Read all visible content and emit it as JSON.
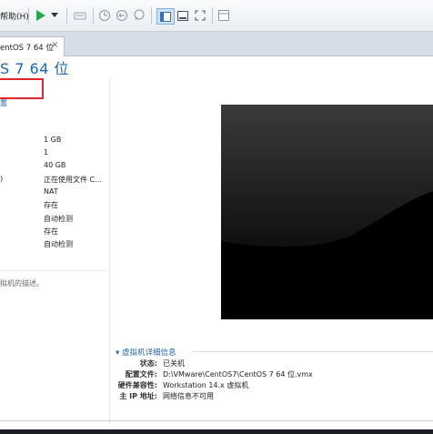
{
  "menu": {
    "help_label": "帮助(H)"
  },
  "toolbar": {
    "icons": [
      "play-icon",
      "dropdown-arrow-icon",
      "send-keys-icon",
      "snapshot-icon",
      "revert-snapshot-icon",
      "snapshot-manager-icon",
      "normal-view-icon",
      "console-view-icon",
      "fullscreen-icon",
      "unity-icon"
    ]
  },
  "tab": {
    "label": "entOS 7 64 位",
    "close": "×"
  },
  "vm": {
    "title": "S 7 64 位"
  },
  "left": {
    "edit_link": "置",
    "devices": [
      {
        "name": "",
        "value": "1 GB"
      },
      {
        "name": "",
        "value": "1"
      },
      {
        "name": "",
        "value": "40 GB"
      },
      {
        "name": ")",
        "value": "正在使用文件 C..."
      },
      {
        "name": "",
        "value": "NAT"
      },
      {
        "name": "",
        "value": "存在"
      },
      {
        "name": "",
        "value": "自动检测"
      },
      {
        "name": "",
        "value": "存在"
      },
      {
        "name": "",
        "value": "自动检测"
      }
    ],
    "description": "拟机的描述。"
  },
  "details": {
    "header": "虚拟机详细信息",
    "rows": [
      {
        "label": "状态:",
        "value": "已关机"
      },
      {
        "label": "配置文件:",
        "value": "D:\\VMware\\CentOS7\\CentOS 7 64 位.vmx"
      },
      {
        "label": "硬件兼容性:",
        "value": "Workstation 14.x 虚拟机"
      },
      {
        "label": "主 IP 地址:",
        "value": "网络信息不可用"
      }
    ]
  },
  "colors": {
    "accent": "#1d66b0",
    "highlight": "#e0262b",
    "play": "#2da44e"
  }
}
